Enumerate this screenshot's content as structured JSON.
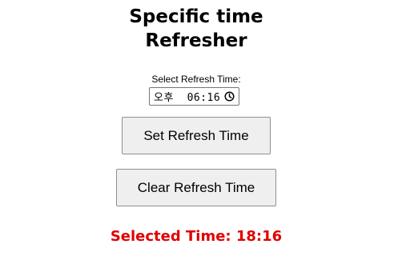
{
  "title": {
    "line1": "Specific time",
    "line2": "Refresher"
  },
  "refresh_time": {
    "label": "Select Refresh Time:",
    "value": "오후  06:16",
    "icon": "clock-icon"
  },
  "buttons": {
    "set_label": "Set Refresh Time",
    "clear_label": "Clear Refresh Time"
  },
  "selected_time": {
    "text": "Selected Time: 18:16",
    "color": "#e00000"
  }
}
